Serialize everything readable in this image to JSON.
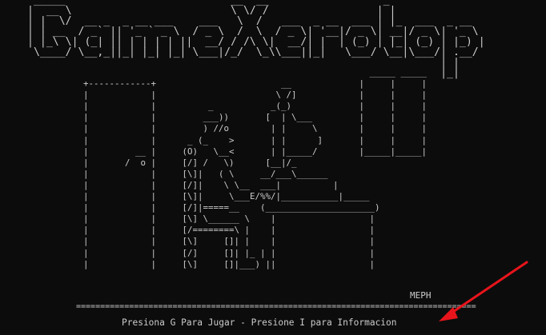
{
  "window": {
    "background": "#0c0c0c",
    "text_color": "#cccccc"
  },
  "title_art": " _____                          __  __                  _             \n|  __ \\                         \\ \\/ /                 | |            \n| |  \\/  __ _  _ __ ___    ___   \\  /   ___  _ __  ___ | |_  ___  _ __\n| | __  / _` || '_ ` _ \\  / _ \\  /  \\  / _ \\| '__|/ _ \\| __|/ _ \\| '_ \\\n| |_\\ \\| (_| || | | | | ||  __/ / /\\ \\|  __/| |  | (_) | |_| (_) | |_) |\n \\____/ \\__,_||_| |_| |_| \\___|/_/  \\_\\\\___||_|   \\___/ \\__|\\___/| .__/\n                                                                 | |   \n                                                                 |_|   ",
  "scene_art": "                                                         _____ _____\n  +------------+                        __             |     |     |\n  |            |                       \\ /]            |     |     |\n  |            |          _           _(_)             |     |     |\n  |            |         ___))       [  | \\___         |     |     |\n  |            |         ) //o        | |     \\        |     |     |\n  |            |      _ (_    >       | |      ]       |     |     |\n  |         __ |     (O)   \\__<       | |_____/        |_____|_____|\n  |       /  o |     [/] /   \\)      [__|/_\n  |            |     [\\]|   ( \\     __/___\\______\n  |            |     [/]|    \\ \\__  ___|          |\n  |            |     [\\]|     \\___E/%%/|___________|_____\n  |            |     [/]|=====__    (_____________________)\n  |            |     [\\] \\______ \\    |                  |\n  |            |     [/========\\ |    |                  |\n  |            |     [\\]     []| |    |                  |\n  |            |     [/]     []| |_ | |                  |\n  |            |     [\\]     []|___) ||                  |",
  "credit": "MEPH",
  "divider": "=====================================================================================================",
  "prompt": "Presiona G Para Jugar - Presione I para Informacion",
  "annotation": {
    "arrow_color": "#e8141b"
  }
}
